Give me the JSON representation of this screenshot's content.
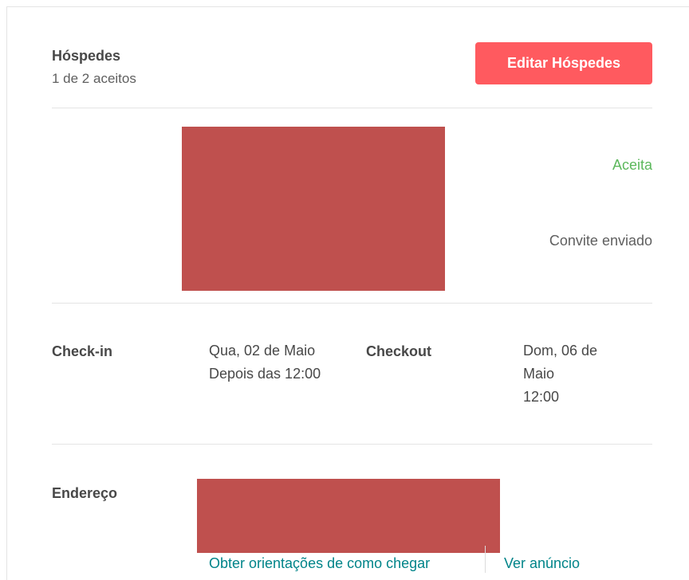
{
  "guests": {
    "title": "Hóspedes",
    "subtitle": "1 de 2 aceitos",
    "edit_button": "Editar Hóspedes",
    "status_accepted": "Aceita",
    "status_invited": "Convite enviado",
    "accent_color": "#ff5a5f",
    "accepted_color": "#5cb85c"
  },
  "dates": {
    "checkin_label": "Check-in",
    "checkin_date": "Qua, 02 de Maio",
    "checkin_time": "Depois das 12:00",
    "checkout_label": "Checkout",
    "checkout_date_line1": "Dom, 06 de",
    "checkout_date_line2": "Maio",
    "checkout_time": "12:00"
  },
  "address": {
    "label": "Endereço",
    "directions_link": "Obter orientações de como chegar",
    "listing_link": "Ver anúncio"
  }
}
